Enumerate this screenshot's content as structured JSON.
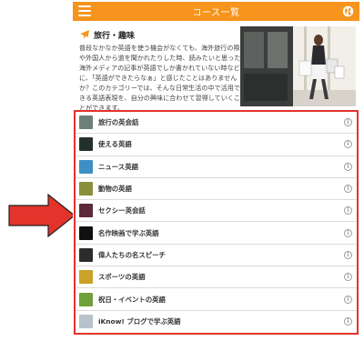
{
  "topbar": {
    "title": "コース一覧"
  },
  "intro": {
    "heading": "旅行・趣味",
    "body": "普段なかなか英語を使う機会がなくても、海外旅行の際や外国人から道を聞かれたりした時、読みたいと思った海外メディアの記事が英語でしか書かれていない時などに、「英語ができたらなぁ」と感じたことはありませんか？このカテゴリーでは、そんな日常生活の中で活用できる英語表現を、自分の興味に合わせて習得していくことができます。"
  },
  "colors": {
    "accent": "#f7941d",
    "highlight": "#e3332b"
  },
  "courses": [
    {
      "label": "旅行の英会話",
      "thumb": "#6d7f78"
    },
    {
      "label": "使える英語",
      "thumb": "#24302b"
    },
    {
      "label": "ニュース英語",
      "thumb": "#3e8fc6"
    },
    {
      "label": "動物の英語",
      "thumb": "#8a8f3c"
    },
    {
      "label": "セクシー英会話",
      "thumb": "#5c2a3c"
    },
    {
      "label": "名作映画で学ぶ英語",
      "thumb": "#111111"
    },
    {
      "label": "偉人たちの名スピーチ",
      "thumb": "#2c2c2c"
    },
    {
      "label": "スポーツの英語",
      "thumb": "#c9a227"
    },
    {
      "label": "祝日・イベントの英語",
      "thumb": "#6fa03a"
    },
    {
      "label": "iKnow! ブログで学ぶ英語",
      "thumb": "#b8c2cc"
    }
  ],
  "icons": {
    "menu": "menu-icon",
    "globe": "globe-icon",
    "plane": "plane-icon",
    "info": "info-icon",
    "arrow": "red-arrow-icon"
  }
}
